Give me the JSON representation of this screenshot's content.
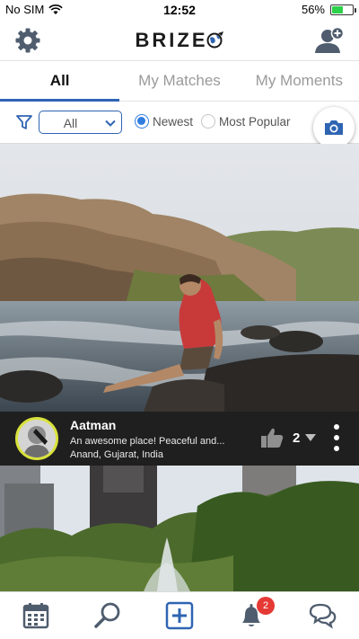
{
  "status_bar": {
    "carrier": "No SIM",
    "time": "12:52",
    "battery_percent": "56%",
    "battery_level": 0.56
  },
  "header": {
    "logo_text": "BRIZE",
    "left_icon": "gear-icon",
    "right_icon": "add-user-icon"
  },
  "tabs": [
    {
      "label": "All",
      "active": true
    },
    {
      "label": "My Matches",
      "active": false
    },
    {
      "label": "My Moments",
      "active": false
    }
  ],
  "filter": {
    "select_value": "All",
    "sort_options": [
      {
        "label": "Newest",
        "selected": true
      },
      {
        "label": "Most Popular",
        "selected": false
      }
    ]
  },
  "post": {
    "user_name": "Aatman",
    "text": "An awesome place! Peaceful and...",
    "location": "Anand, Gujarat, India",
    "likes": "2"
  },
  "bottom_nav": {
    "items": [
      "calendar-icon",
      "search-icon",
      "add-icon",
      "bell-icon",
      "chat-icon"
    ],
    "notification_badge": "2"
  },
  "colors": {
    "accent": "#2f64b3",
    "badge": "#e53935",
    "avatar_ring": "#d9e23a"
  }
}
